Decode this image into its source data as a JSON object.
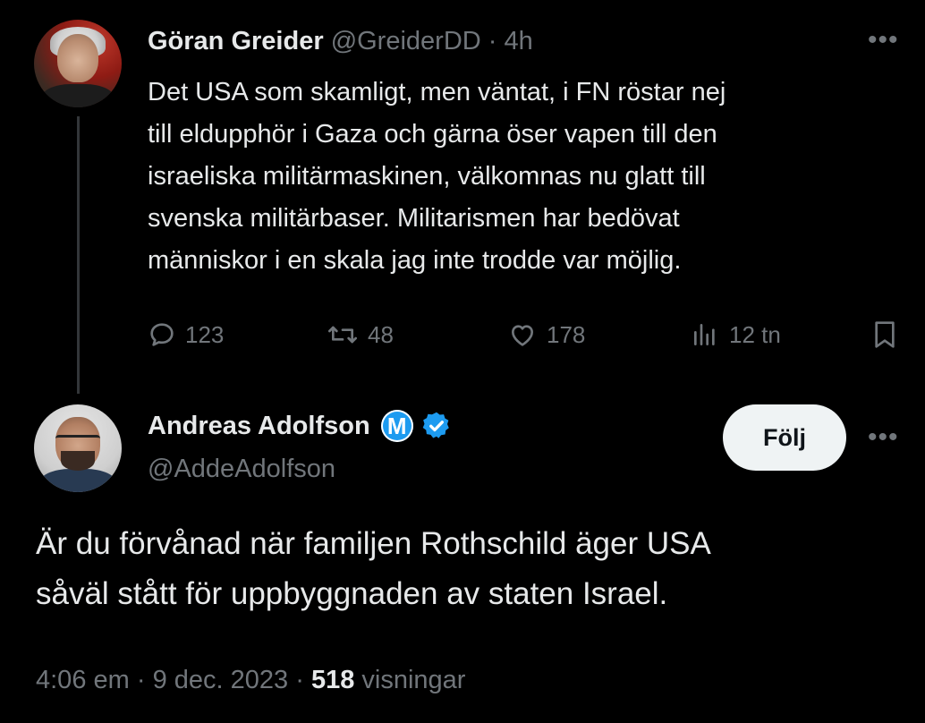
{
  "parent_tweet": {
    "author_name": "Göran Greider",
    "handle": "@GreiderDD",
    "separator": " · ",
    "time": "4h",
    "text_lines": [
      "Det USA som skamligt, men väntat, i FN röstar nej",
      "till eldupphör i Gaza och gärna öser vapen till den",
      "israeliska militärmaskinen, välkomnas nu glatt till",
      "svenska militärbaser. Militarismen har bedövat",
      "människor i en skala jag inte trodde var möjlig."
    ],
    "actions": {
      "replies": "123",
      "reposts": "48",
      "likes": "178",
      "views": "12 tn"
    },
    "more_label": "•••"
  },
  "main_tweet": {
    "author_name": "Andreas Adolfson",
    "badge_letter": "M",
    "handle": "@AddeAdolfson",
    "follow_label": "Följ",
    "more_label": "•••",
    "text_lines": [
      "Är du förvånad när familjen Rothschild äger USA",
      "såväl stått för uppbyggnaden av staten Israel."
    ],
    "footer": {
      "time": "4:06 em",
      "separator": " · ",
      "date": "9 dec. 2023",
      "views_count": "518",
      "views_label": "visningar"
    }
  },
  "colors": {
    "background": "#000000",
    "text_primary": "#e7e9ea",
    "text_secondary": "#71767b",
    "accent_blue": "#1d9bf0",
    "follow_bg": "#eff3f4"
  },
  "icons": {
    "reply": "reply-icon",
    "repost": "repost-icon",
    "like": "like-icon",
    "views": "views-icon",
    "bookmark": "bookmark-icon",
    "verified": "verified-badge-icon"
  }
}
